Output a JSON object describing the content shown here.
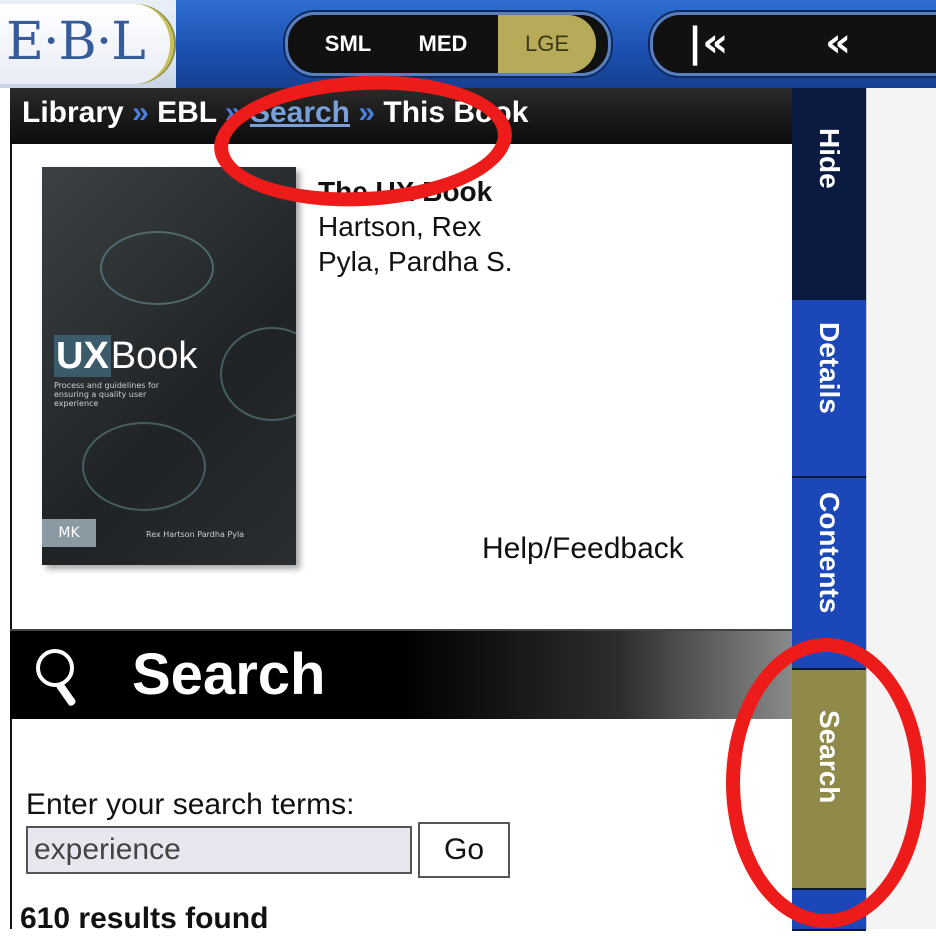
{
  "app": {
    "logo_text": "E·B·L"
  },
  "toolbar": {
    "size_small": "SML",
    "size_medium": "MED",
    "size_large": "LGE",
    "nav_first": "|<<",
    "nav_prev": "<<"
  },
  "breadcrumb": {
    "items": [
      "Library",
      "EBL",
      "Search",
      "This Book"
    ],
    "separator": "»"
  },
  "book": {
    "title": "The UX Book",
    "authors": [
      "Hartson, Rex",
      "Pyla, Pardha S."
    ],
    "cover_title_prefix": "UX",
    "cover_title_suffix": "Book",
    "cover_publisher": "MK",
    "cover_authors": "Rex Hartson   Pardha Pyla",
    "cover_tagline": "Process and guidelines for ensuring a quality user experience"
  },
  "links": {
    "help": "Help/Feedback"
  },
  "search": {
    "heading": "Search",
    "label": "Enter your search terms:",
    "value": "experience",
    "go_label": "Go",
    "results": "610 results found"
  },
  "side_tabs": {
    "hide": "Hide",
    "details": "Details",
    "contents": "Contents",
    "search": "Search",
    "active": "Search"
  },
  "colors": {
    "toolbar_blue": "#1b4fb0",
    "tab_blue": "#1b47b8",
    "active_tab": "#8f8a48",
    "annotation_red": "#ee1b1b"
  }
}
